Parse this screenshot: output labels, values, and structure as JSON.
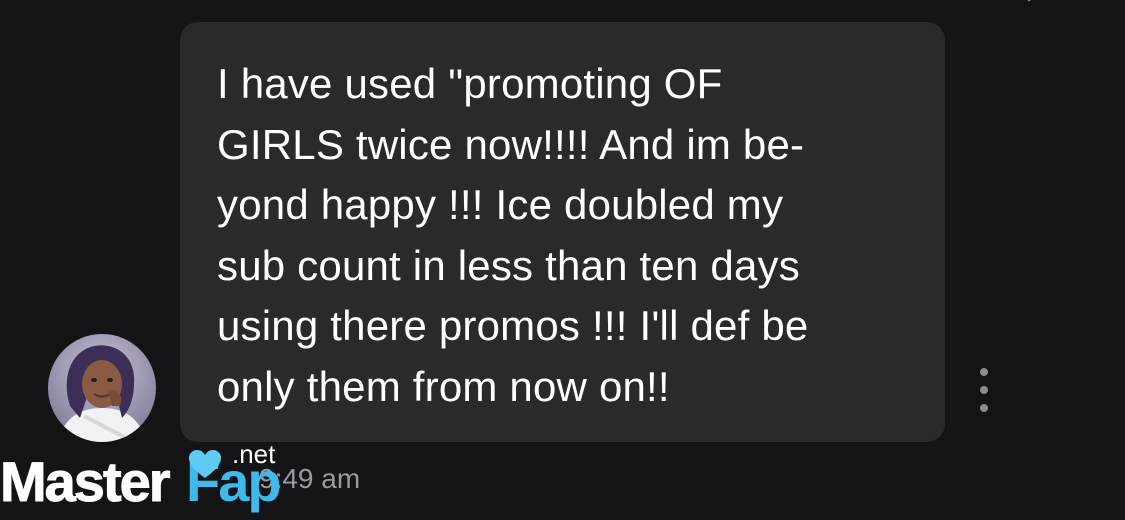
{
  "message": {
    "lines": [
      "I have used \"promoting OF",
      "GIRLS twice now!!!! And im be-",
      "yond happy !!! Ice doubled my",
      "sub count in less than ten days",
      "using there promos !!! I'll def be",
      "only them from now on!!"
    ],
    "timestamp": "9:49 am"
  },
  "icons": {
    "top": "chevron-down-icon",
    "more": "more-vertical-icon",
    "avatar": "user-avatar"
  },
  "watermark": {
    "master": "Master",
    "fap": "Fap",
    "net": ".net"
  },
  "colors": {
    "background": "#141416",
    "bubble": "#2a2a2c",
    "message_text": "#ffffff",
    "timestamp_text": "#9a9a9e",
    "watermark_accent": "#3fb8ea"
  }
}
